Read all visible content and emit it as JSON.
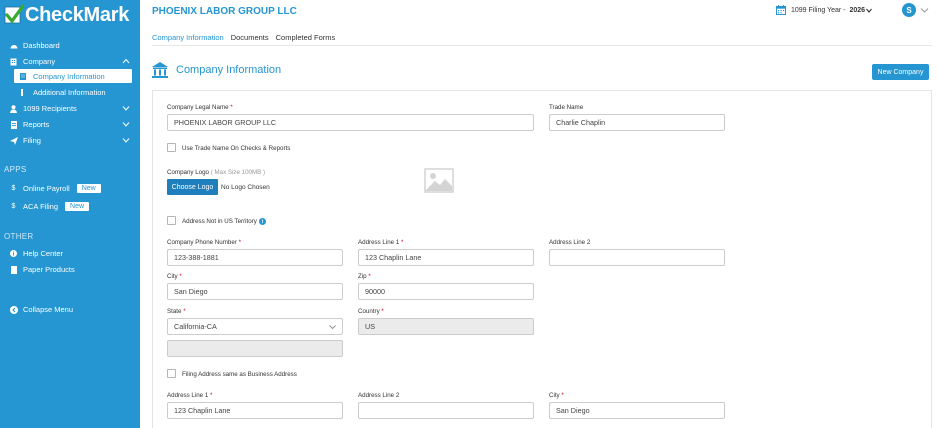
{
  "app": {
    "brand": "CheckMark"
  },
  "sidebar": {
    "nav": [
      {
        "label": "Dashboard"
      },
      {
        "label": "Company"
      },
      {
        "label": "1099 Recipients"
      },
      {
        "label": "Reports"
      },
      {
        "label": "Filing"
      }
    ],
    "company_sub": [
      {
        "label": "Company Information"
      },
      {
        "label": "Additional Information"
      }
    ],
    "apps_title": "APPS",
    "apps": [
      {
        "label": "Online Payroll",
        "badge": "New"
      },
      {
        "label": "ACA Filing",
        "badge": "New"
      }
    ],
    "other_title": "OTHER",
    "other": [
      {
        "label": "Help Center"
      },
      {
        "label": "Paper Products"
      }
    ],
    "collapse_label": "Collapse Menu"
  },
  "header": {
    "company_name": "PHOENIX LABOR GROUP LLC",
    "filing_year_label": "1099 Filing Year -",
    "filing_year_value": "2026",
    "avatar_initial": "S"
  },
  "tabs": [
    {
      "label": "Company Information",
      "active": true
    },
    {
      "label": "Documents",
      "active": false
    },
    {
      "label": "Completed Forms",
      "active": false
    }
  ],
  "page": {
    "title": "Company Information",
    "new_company_button": "New Company"
  },
  "form": {
    "legal_name": {
      "label": "Company Legal Name",
      "required": "*",
      "value": "PHOENIX LABOR GROUP LLC"
    },
    "trade_name": {
      "label": "Trade Name",
      "value": "Charlie Chaplin"
    },
    "use_trade_name": {
      "label": "Use Trade Name On Checks & Reports"
    },
    "logo": {
      "label": "Company Logo",
      "hint": "( Max Size 100MB )",
      "button": "Choose Logo",
      "status": "No Logo Chosen"
    },
    "not_us": {
      "label": "Address Not in US Territory"
    },
    "phone": {
      "label": "Company Phone Number",
      "required": "*",
      "value": "123-388-1881"
    },
    "address1": {
      "label": "Address Line 1",
      "required": "*",
      "value": "123 Chaplin Lane"
    },
    "address2": {
      "label": "Address Line 2",
      "value": ""
    },
    "city": {
      "label": "City",
      "required": "*",
      "value": "San Diego"
    },
    "zip": {
      "label": "Zip",
      "required": "*",
      "value": "90000"
    },
    "state": {
      "label": "State",
      "required": "*",
      "value": "California-CA"
    },
    "country": {
      "label": "Country",
      "required": "*",
      "value": "US"
    },
    "filing_same": {
      "label": "Filing Address same as Business Address"
    },
    "filing_address1": {
      "label": "Address Line 1",
      "required": "*",
      "value": "123 Chaplin Lane"
    },
    "filing_address2": {
      "label": "Address Line 2",
      "value": ""
    },
    "filing_city": {
      "label": "City",
      "required": "*",
      "value": "San Diego"
    }
  },
  "colors": {
    "brand": "#2596d1",
    "required": "#d0021b"
  }
}
